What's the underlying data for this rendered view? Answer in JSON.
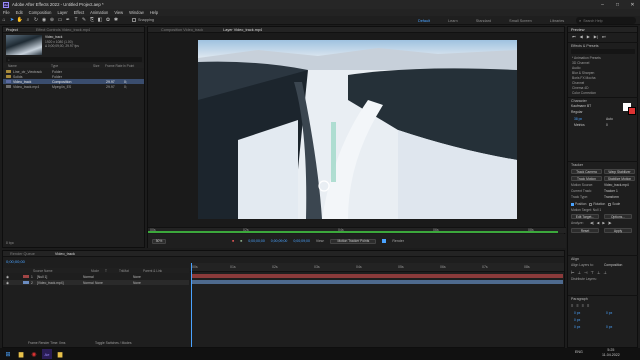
{
  "window": {
    "title": "Adobe After Effects 2022 - Untitled Project.aep *",
    "logo": "Ae"
  },
  "menu": [
    "File",
    "Edit",
    "Composition",
    "Layer",
    "Effect",
    "Animation",
    "View",
    "Window",
    "Help"
  ],
  "toolbar": {
    "snapping": "Snapping"
  },
  "workspaces": [
    "Default",
    "Learn",
    "Standard",
    "Small Screen",
    "Libraries"
  ],
  "search_placeholder": "Search Help",
  "project": {
    "tab": "Project",
    "effect_controls_tab": "Effect Controls Video_track.mp4",
    "preview_name": "Video_track",
    "preview_info": [
      "1920 x 1080 (1.00)",
      "Δ 0;00;09;00, 29.97 fps"
    ],
    "search_placeholder": "",
    "columns": [
      "Name",
      "Type",
      "Size",
      "Frame Rate",
      "In Point"
    ],
    "items": [
      {
        "name": "Line_ctr_Vieotrack",
        "type": "Folder",
        "size": "",
        "rate": "",
        "in": ""
      },
      {
        "name": "Solids",
        "type": "Folder",
        "size": "",
        "rate": "",
        "in": ""
      },
      {
        "name": "Video_track",
        "type": "Composition",
        "size": "",
        "rate": "29.97",
        "in": "0;"
      },
      {
        "name": "Video_track.mp4",
        "type": "Mpeg4n_ES",
        "size": "",
        "rate": "29.97",
        "in": "0;"
      }
    ],
    "footer": "8 bpc"
  },
  "viewer": {
    "comp_tab": "Composition Video_track",
    "layer_tab": "Layer Video_track.mp4",
    "ruler": [
      "00s",
      "02s",
      "04s",
      "06s",
      "08s"
    ],
    "zoom": "50%",
    "resolution": "Full",
    "timecode_in": "0;00;00;00",
    "timecode_out": "0;00;09;00",
    "duration": "0;00;09;00",
    "view_label": "View:",
    "view_value": "Motion Tracker Points",
    "render_label": "Render"
  },
  "right": {
    "preview": {
      "tab": "Preview"
    },
    "effects": {
      "tab": "Effects & Presets",
      "search_placeholder": "",
      "items": [
        "* Animation Presets",
        "3D Channel",
        "Audio",
        "Blur & Sharpen",
        "Boris FX Mocha",
        "Channel",
        "Cinema 4D",
        "Color Correction"
      ]
    },
    "character": {
      "tab": "Character",
      "font": "Kaufmann BT",
      "style": "Regular",
      "size": "38 px",
      "leading": "Auto",
      "tracking": "Metrics",
      "kerning": "0"
    },
    "tracker": {
      "tab": "Tracker",
      "buttons": [
        "Track Camera",
        "Warp Stabilizer",
        "Track Motion",
        "Stabilize Motion"
      ],
      "motion_source_label": "Motion Source:",
      "motion_source": "Video_track.mp4",
      "current_track_label": "Current Track:",
      "current_track": "Tracker 1",
      "track_type_label": "Track Type:",
      "track_type": "Transform",
      "checks": [
        "Position",
        "Rotation",
        "Scale"
      ],
      "motion_target": "Motion Target: Null 1",
      "edit_target": "Edit Target...",
      "options": "Options...",
      "analyze": "Analyze:",
      "reset": "Reset",
      "apply": "Apply"
    },
    "align": {
      "tab": "Align",
      "align_to_label": "Align Layers to:",
      "align_to": "Composition",
      "distribute": "Distribute Layers:"
    },
    "paragraph": {
      "tab": "Paragraph",
      "vals": [
        "0 px",
        "0 px",
        "0 px",
        "0 px",
        "0 px"
      ]
    }
  },
  "timeline": {
    "render_queue_tab": "Render Queue",
    "comp_tab": "Video_track",
    "timecode": "0;00;00;00",
    "columns": [
      "Source Name",
      "Mode",
      "T",
      "TrkMat",
      "Parent & Link"
    ],
    "layers": [
      {
        "num": "1",
        "name": "[Null 1]",
        "mode": "Normal",
        "trkmat": "",
        "parent": "None"
      },
      {
        "num": "2",
        "name": "[Video_track.mp4]",
        "mode": "Normal",
        "trkmat": "None",
        "parent": "None"
      }
    ],
    "ruler": [
      "00s",
      "01s",
      "02s",
      "03s",
      "04s",
      "05s",
      "06s",
      "07s",
      "08s"
    ],
    "footer_left": "Frame Render Time: 0ms",
    "footer_mid": "Toggle Switches / Modes"
  },
  "taskbar": {
    "lang": "ENG",
    "time": "5:25",
    "date": "11.04.2022"
  },
  "colors": {
    "accent": "#4aa3ff",
    "track_green": "#3ca83c",
    "layer_red": "#a04545",
    "layer_blue": "#6b8cc0"
  }
}
